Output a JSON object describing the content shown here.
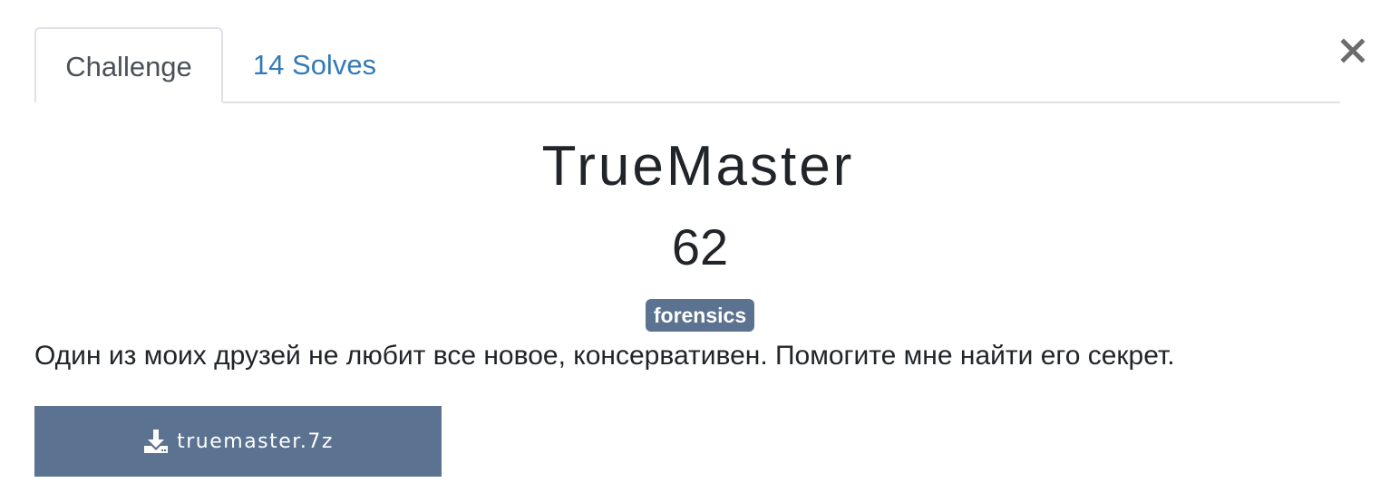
{
  "tabs": [
    {
      "label": "Challenge",
      "active": true
    },
    {
      "label": "14 Solves",
      "active": false
    }
  ],
  "close_icon": "close-icon",
  "challenge": {
    "name": "TrueMaster",
    "points": "62",
    "tag": "forensics",
    "description": "Один из моих друзей не любит все новое, консервативен. Помогите мне найти его секрет."
  },
  "files": [
    {
      "label": "truemaster.7z",
      "icon": "download-icon"
    }
  ],
  "colors": {
    "accent": "#5b7290",
    "link": "#337ab7",
    "border": "#dee2e6"
  }
}
